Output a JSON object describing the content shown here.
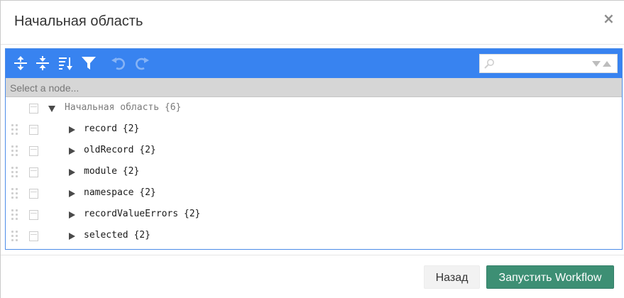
{
  "dialog": {
    "title": "Начальная область",
    "close_label": "×"
  },
  "toolbar": {
    "buttons": [
      {
        "name": "expand-all-icon",
        "title": "Expand all"
      },
      {
        "name": "collapse-all-icon",
        "title": "Collapse all"
      },
      {
        "name": "sort-icon",
        "title": "Sort"
      },
      {
        "name": "filter-icon",
        "title": "Filter"
      },
      {
        "name": "undo-icon",
        "title": "Undo"
      },
      {
        "name": "redo-icon",
        "title": "Redo"
      }
    ],
    "accent_color": "#3883f0"
  },
  "search": {
    "value": "",
    "placeholder": ""
  },
  "navbar": {
    "text": "Select a node..."
  },
  "tree": {
    "root": {
      "label": "Начальная область {6}",
      "expanded": true
    },
    "children": [
      {
        "label": "record {2}",
        "expanded": false
      },
      {
        "label": "oldRecord {2}",
        "expanded": false
      },
      {
        "label": "module {2}",
        "expanded": false
      },
      {
        "label": "namespace {2}",
        "expanded": false
      },
      {
        "label": "recordValueErrors {2}",
        "expanded": false
      },
      {
        "label": "selected {2}",
        "expanded": false
      }
    ]
  },
  "footer": {
    "back_label": "Назад",
    "run_label": "Запустить Workflow",
    "run_color": "#3d8f74"
  }
}
